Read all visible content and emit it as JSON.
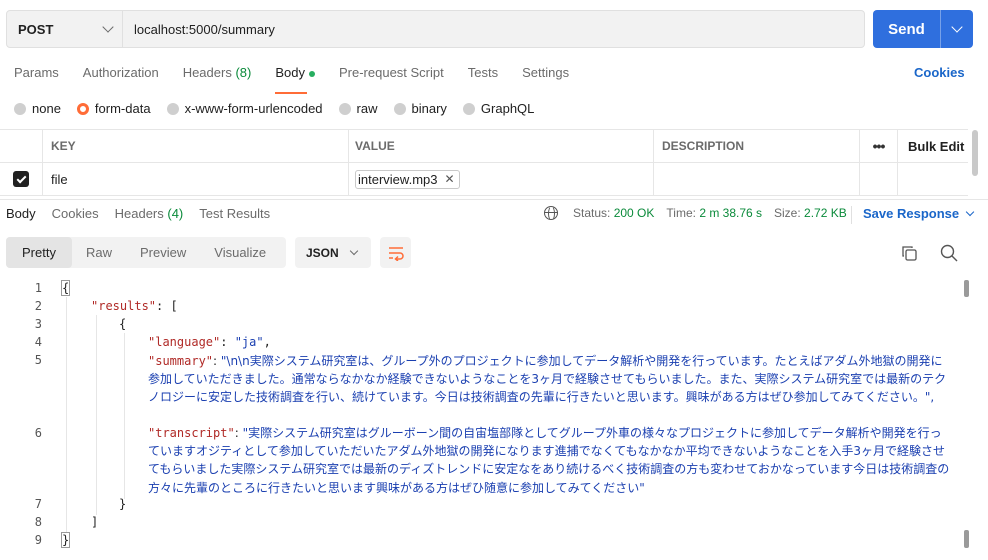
{
  "request": {
    "method": "POST",
    "url": "localhost:5000/summary",
    "send_label": "Send"
  },
  "request_tabs": {
    "params": "Params",
    "authorization": "Authorization",
    "headers": "Headers",
    "headers_count": "(8)",
    "body": "Body",
    "prerequest": "Pre-request Script",
    "tests": "Tests",
    "settings": "Settings",
    "cookies": "Cookies"
  },
  "body_types": {
    "none": "none",
    "form_data": "form-data",
    "urlencoded": "x-www-form-urlencoded",
    "raw": "raw",
    "binary": "binary",
    "graphql": "GraphQL",
    "selected": "form-data"
  },
  "form_table": {
    "headers": {
      "key": "KEY",
      "value": "VALUE",
      "description": "DESCRIPTION",
      "bulk_edit": "Bulk Edit"
    },
    "rows": [
      {
        "checked": true,
        "key": "file",
        "value": "interview.mp3",
        "description": ""
      }
    ]
  },
  "response": {
    "tabs": {
      "body": "Body",
      "cookies": "Cookies",
      "headers": "Headers",
      "headers_count": "(4)",
      "test_results": "Test Results"
    },
    "status_label": "Status:",
    "status_value": "200 OK",
    "time_label": "Time:",
    "time_value": "2 m 38.76 s",
    "size_label": "Size:",
    "size_value": "2.72 KB",
    "save_label": "Save Response"
  },
  "view": {
    "pretty": "Pretty",
    "raw": "Raw",
    "preview": "Preview",
    "visualize": "Visualize",
    "format": "JSON"
  },
  "code": {
    "line_numbers": [
      "1",
      "2",
      "3",
      "4",
      "5",
      "6",
      "7",
      "8",
      "9"
    ],
    "open_brace": "{",
    "results_key": "\"results\"",
    "results_open": ": [",
    "obj_open": "{",
    "language_key": "\"language\"",
    "language_value": "\"ja\"",
    "summary_key": "\"summary\"",
    "summary_value": "\"\\n\\n実際システム研究室は、グループ外のプロジェクトに参加してデータ解析や開発を行っています。たとえばアダム外地獄の開発に参加していただきました。通常ならなかなか経験できないようなことを3ヶ月で経験させてもらいました。また、実際システム研究室では最新のテクノロジーに安定した技術調査を行い、続けています。今日は技術調査の先輩に行きたいと思います。興味がある方はぜひ参加してみてください。\",",
    "transcript_key": "\"transcript\"",
    "transcript_value": "\"実際システム研究室はグルーボーン間の自宙塩部隊としてグループ外車の様々なプロジェクトに参加してデータ解析や開発を行っていますオジティとして参加していただいたアダム外地獄の開発になります進捕でなくてもなかなか平均できないようなことを入手3ヶ月で経験させてもらいました実際システム研究室では最新のディズトレンドに安定なをあり続けるべく技術調査の方も変わせておかなっています今日は技術調査の方々に先輩のところに行きたいと思います興味がある方はぜひ随意に参加してみてください\"",
    "obj_close": "}",
    "results_close": "]",
    "close_brace": "}"
  },
  "colors": {
    "send": "#2f6fde",
    "accent": "#ff6c37",
    "status_ok": "#0a8a3a",
    "link": "#1a66c9",
    "json_key": "#b02a27",
    "json_string": "#1a3fb0"
  },
  "icons": [
    "chevron-down-icon",
    "checkbox-icon",
    "remove-file-icon",
    "more-options-icon",
    "globe-icon",
    "wrap-lines-icon",
    "copy-icon",
    "search-icon"
  ]
}
